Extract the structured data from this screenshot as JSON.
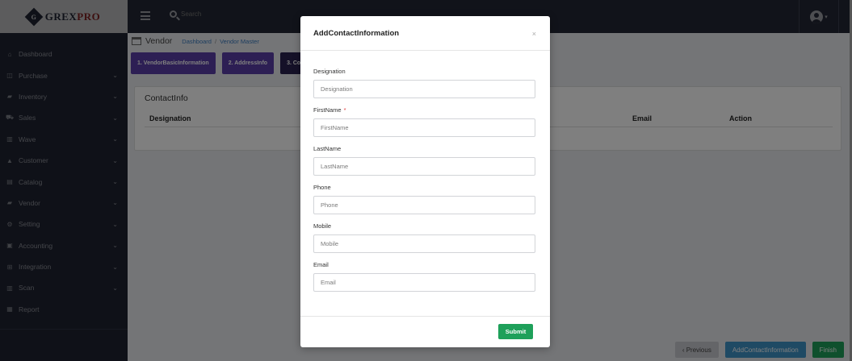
{
  "brand": {
    "mark": "G",
    "name_a": "GREX",
    "name_b": "PRO"
  },
  "topbar": {
    "search_placeholder": "Search"
  },
  "sidebar": {
    "items": [
      {
        "label": "Dashboard",
        "icon": "home-icon",
        "glyph": "⌂",
        "has_children": false
      },
      {
        "label": "Purchase",
        "icon": "basket-icon",
        "glyph": "◫",
        "has_children": true
      },
      {
        "label": "Inventory",
        "icon": "truck-icon",
        "glyph": "▰",
        "has_children": true
      },
      {
        "label": "Sales",
        "icon": "cart-icon",
        "glyph": "⛟",
        "has_children": true
      },
      {
        "label": "Wave",
        "icon": "book-icon",
        "glyph": "▥",
        "has_children": true
      },
      {
        "label": "Customer",
        "icon": "warning-icon",
        "glyph": "▲",
        "has_children": true
      },
      {
        "label": "Catalog",
        "icon": "folder-icon",
        "glyph": "▤",
        "has_children": true
      },
      {
        "label": "Vendor",
        "icon": "truck-icon",
        "glyph": "▰",
        "has_children": true
      },
      {
        "label": "Setting",
        "icon": "gear-icon",
        "glyph": "⚙",
        "has_children": true
      },
      {
        "label": "Accounting",
        "icon": "briefcase-icon",
        "glyph": "▣",
        "has_children": true
      },
      {
        "label": "Integration",
        "icon": "plug-icon",
        "glyph": "⊞",
        "has_children": true
      },
      {
        "label": "Scan",
        "icon": "book-icon",
        "glyph": "▥",
        "has_children": true
      },
      {
        "label": "Report",
        "icon": "chart-icon",
        "glyph": "▦",
        "has_children": false
      }
    ]
  },
  "page": {
    "title": "Vendor",
    "breadcrumb": [
      "Dashboard",
      "Vendor Master"
    ],
    "steps": [
      "1. VendorBasicInformation",
      "2. AddressInfo",
      "3. Co"
    ],
    "card_title": "ContactInfo",
    "columns": [
      "Designation",
      "Email",
      "Action"
    ],
    "footer": {
      "previous": "‹ Previous",
      "add_contact": "AddContactInformation",
      "finish": "Finish"
    }
  },
  "modal": {
    "title": "AddContactInformation",
    "close": "×",
    "fields": [
      {
        "label": "Designation",
        "placeholder": "Designation",
        "required": false
      },
      {
        "label": "FirstName",
        "placeholder": "FirstName",
        "required": true
      },
      {
        "label": "LastName",
        "placeholder": "LastName",
        "required": false
      },
      {
        "label": "Phone",
        "placeholder": "Phone",
        "required": false
      },
      {
        "label": "Mobile",
        "placeholder": "Mobile",
        "required": false
      },
      {
        "label": "Email",
        "placeholder": "Email",
        "required": false
      }
    ],
    "required_mark": "*",
    "submit": "Submit"
  },
  "colors": {
    "sidebar": "#1f2330",
    "accent_purple": "#5b3fa8",
    "success": "#1ea05a",
    "info": "#3e94c8"
  }
}
